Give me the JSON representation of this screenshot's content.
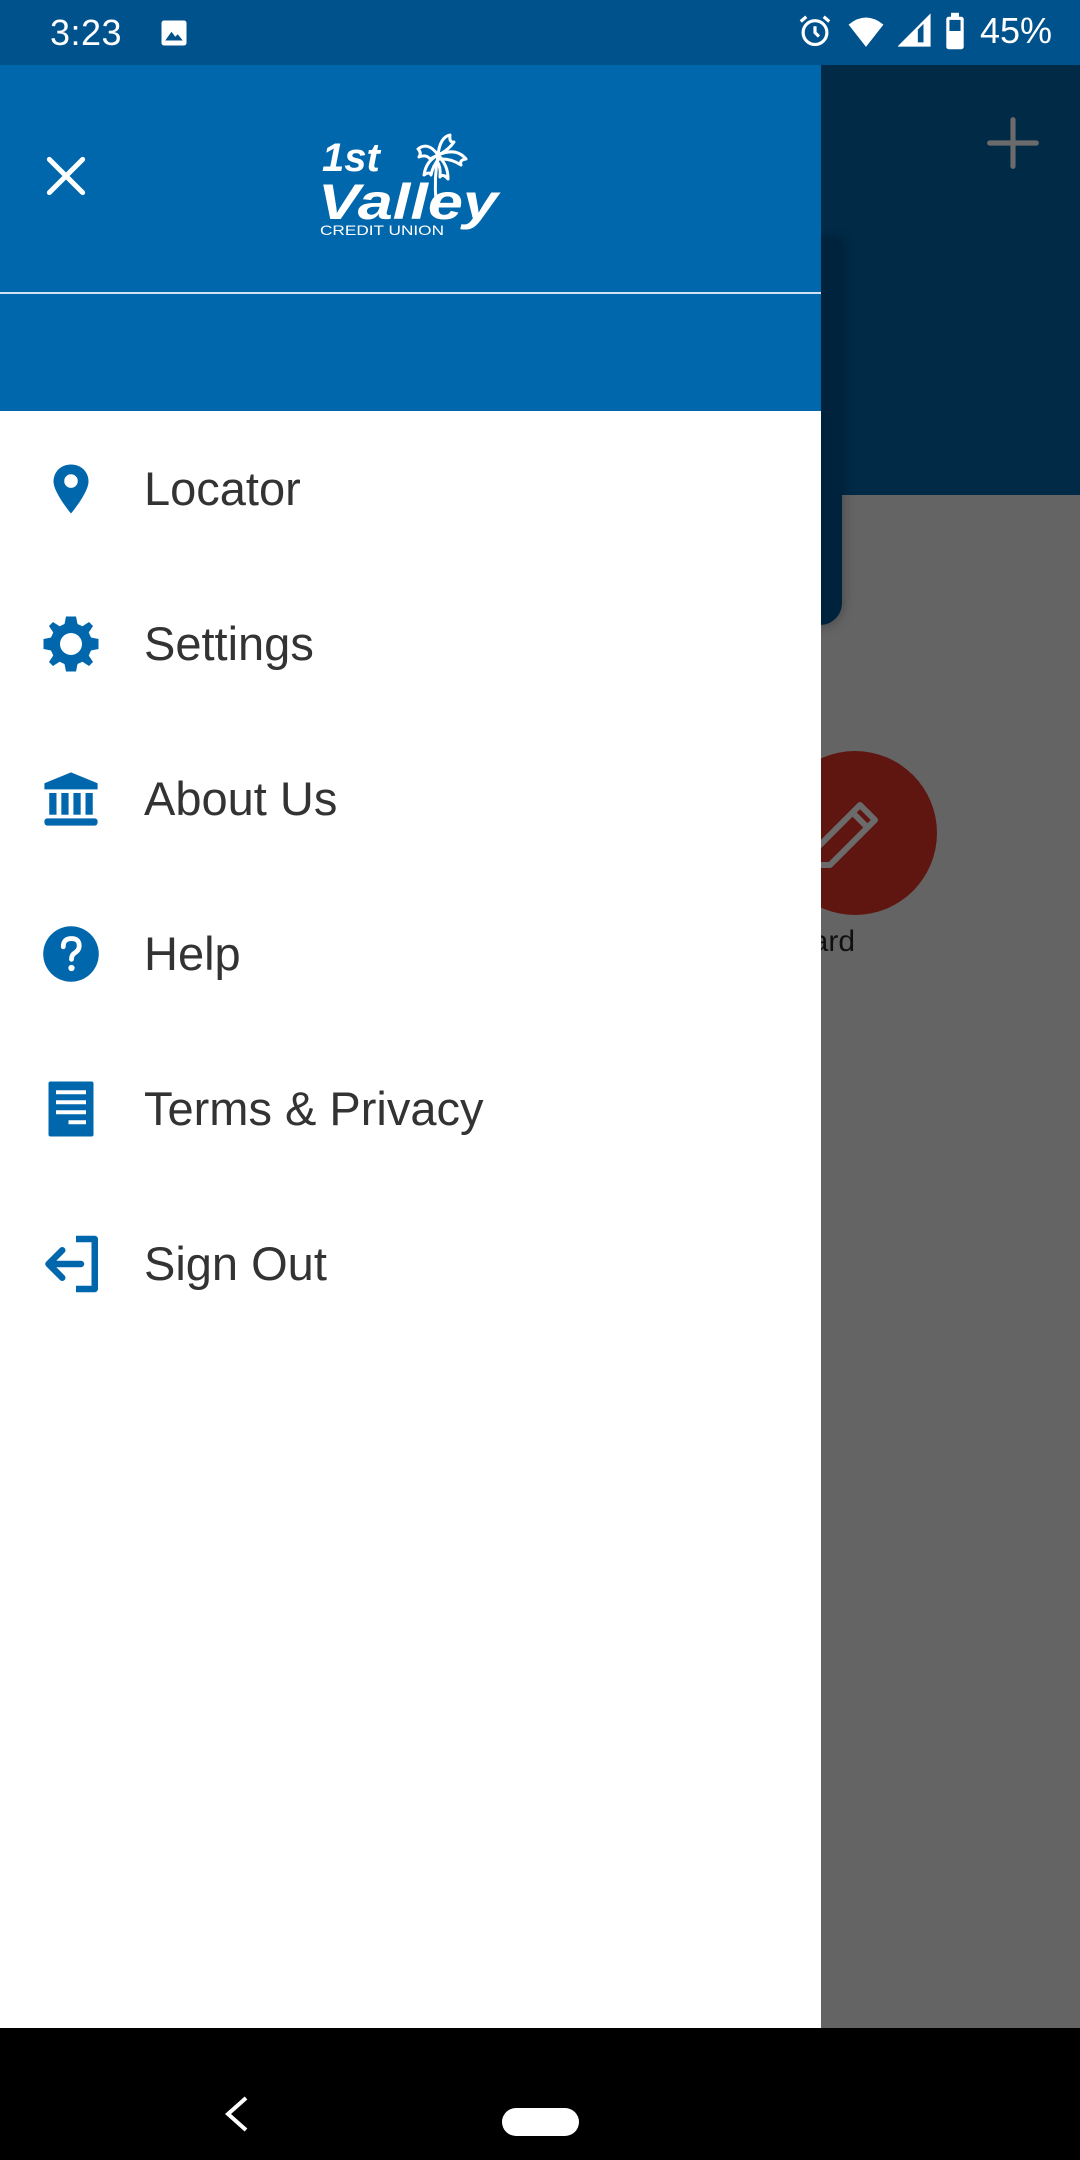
{
  "status_bar": {
    "time": "3:23",
    "battery_percent": "45%",
    "icons": [
      "image-notification-icon",
      "alarm-icon",
      "wifi-icon",
      "cell-signal-icon",
      "battery-icon"
    ]
  },
  "drawer": {
    "logo": {
      "line1": "1st",
      "line2": "Valley",
      "line3": "CREDIT UNION"
    },
    "close_icon": "close-icon",
    "menu": [
      {
        "label": "Locator",
        "icon": "location-pin-icon"
      },
      {
        "label": "Settings",
        "icon": "gear-icon"
      },
      {
        "label": "About Us",
        "icon": "bank-building-icon"
      },
      {
        "label": "Help",
        "icon": "help-circle-icon"
      },
      {
        "label": "Terms & Privacy",
        "icon": "document-icon"
      },
      {
        "label": "Sign Out",
        "icon": "sign-out-icon"
      }
    ]
  },
  "background_app": {
    "add_icon": "plus-icon",
    "action_label_partial": "lit Card",
    "action_icon": "pencil-icon"
  },
  "colors": {
    "brand_blue": "#0067ad",
    "status_bar": "#00528c",
    "menu_text": "#333333",
    "scrim_gray": "#646464",
    "action_red_dimmed": "#5f1610"
  }
}
